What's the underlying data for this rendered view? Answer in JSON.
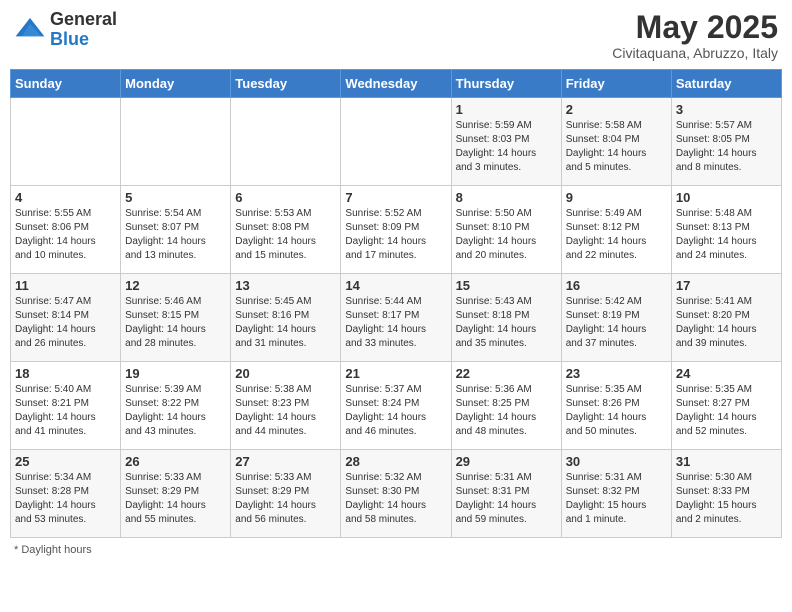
{
  "header": {
    "logo_general": "General",
    "logo_blue": "Blue",
    "month_title": "May 2025",
    "subtitle": "Civitaquana, Abruzzo, Italy"
  },
  "weekdays": [
    "Sunday",
    "Monday",
    "Tuesday",
    "Wednesday",
    "Thursday",
    "Friday",
    "Saturday"
  ],
  "weeks": [
    [
      {
        "day": "",
        "info": ""
      },
      {
        "day": "",
        "info": ""
      },
      {
        "day": "",
        "info": ""
      },
      {
        "day": "",
        "info": ""
      },
      {
        "day": "1",
        "info": "Sunrise: 5:59 AM\nSunset: 8:03 PM\nDaylight: 14 hours\nand 3 minutes."
      },
      {
        "day": "2",
        "info": "Sunrise: 5:58 AM\nSunset: 8:04 PM\nDaylight: 14 hours\nand 5 minutes."
      },
      {
        "day": "3",
        "info": "Sunrise: 5:57 AM\nSunset: 8:05 PM\nDaylight: 14 hours\nand 8 minutes."
      }
    ],
    [
      {
        "day": "4",
        "info": "Sunrise: 5:55 AM\nSunset: 8:06 PM\nDaylight: 14 hours\nand 10 minutes."
      },
      {
        "day": "5",
        "info": "Sunrise: 5:54 AM\nSunset: 8:07 PM\nDaylight: 14 hours\nand 13 minutes."
      },
      {
        "day": "6",
        "info": "Sunrise: 5:53 AM\nSunset: 8:08 PM\nDaylight: 14 hours\nand 15 minutes."
      },
      {
        "day": "7",
        "info": "Sunrise: 5:52 AM\nSunset: 8:09 PM\nDaylight: 14 hours\nand 17 minutes."
      },
      {
        "day": "8",
        "info": "Sunrise: 5:50 AM\nSunset: 8:10 PM\nDaylight: 14 hours\nand 20 minutes."
      },
      {
        "day": "9",
        "info": "Sunrise: 5:49 AM\nSunset: 8:12 PM\nDaylight: 14 hours\nand 22 minutes."
      },
      {
        "day": "10",
        "info": "Sunrise: 5:48 AM\nSunset: 8:13 PM\nDaylight: 14 hours\nand 24 minutes."
      }
    ],
    [
      {
        "day": "11",
        "info": "Sunrise: 5:47 AM\nSunset: 8:14 PM\nDaylight: 14 hours\nand 26 minutes."
      },
      {
        "day": "12",
        "info": "Sunrise: 5:46 AM\nSunset: 8:15 PM\nDaylight: 14 hours\nand 28 minutes."
      },
      {
        "day": "13",
        "info": "Sunrise: 5:45 AM\nSunset: 8:16 PM\nDaylight: 14 hours\nand 31 minutes."
      },
      {
        "day": "14",
        "info": "Sunrise: 5:44 AM\nSunset: 8:17 PM\nDaylight: 14 hours\nand 33 minutes."
      },
      {
        "day": "15",
        "info": "Sunrise: 5:43 AM\nSunset: 8:18 PM\nDaylight: 14 hours\nand 35 minutes."
      },
      {
        "day": "16",
        "info": "Sunrise: 5:42 AM\nSunset: 8:19 PM\nDaylight: 14 hours\nand 37 minutes."
      },
      {
        "day": "17",
        "info": "Sunrise: 5:41 AM\nSunset: 8:20 PM\nDaylight: 14 hours\nand 39 minutes."
      }
    ],
    [
      {
        "day": "18",
        "info": "Sunrise: 5:40 AM\nSunset: 8:21 PM\nDaylight: 14 hours\nand 41 minutes."
      },
      {
        "day": "19",
        "info": "Sunrise: 5:39 AM\nSunset: 8:22 PM\nDaylight: 14 hours\nand 43 minutes."
      },
      {
        "day": "20",
        "info": "Sunrise: 5:38 AM\nSunset: 8:23 PM\nDaylight: 14 hours\nand 44 minutes."
      },
      {
        "day": "21",
        "info": "Sunrise: 5:37 AM\nSunset: 8:24 PM\nDaylight: 14 hours\nand 46 minutes."
      },
      {
        "day": "22",
        "info": "Sunrise: 5:36 AM\nSunset: 8:25 PM\nDaylight: 14 hours\nand 48 minutes."
      },
      {
        "day": "23",
        "info": "Sunrise: 5:35 AM\nSunset: 8:26 PM\nDaylight: 14 hours\nand 50 minutes."
      },
      {
        "day": "24",
        "info": "Sunrise: 5:35 AM\nSunset: 8:27 PM\nDaylight: 14 hours\nand 52 minutes."
      }
    ],
    [
      {
        "day": "25",
        "info": "Sunrise: 5:34 AM\nSunset: 8:28 PM\nDaylight: 14 hours\nand 53 minutes."
      },
      {
        "day": "26",
        "info": "Sunrise: 5:33 AM\nSunset: 8:29 PM\nDaylight: 14 hours\nand 55 minutes."
      },
      {
        "day": "27",
        "info": "Sunrise: 5:33 AM\nSunset: 8:29 PM\nDaylight: 14 hours\nand 56 minutes."
      },
      {
        "day": "28",
        "info": "Sunrise: 5:32 AM\nSunset: 8:30 PM\nDaylight: 14 hours\nand 58 minutes."
      },
      {
        "day": "29",
        "info": "Sunrise: 5:31 AM\nSunset: 8:31 PM\nDaylight: 14 hours\nand 59 minutes."
      },
      {
        "day": "30",
        "info": "Sunrise: 5:31 AM\nSunset: 8:32 PM\nDaylight: 15 hours\nand 1 minute."
      },
      {
        "day": "31",
        "info": "Sunrise: 5:30 AM\nSunset: 8:33 PM\nDaylight: 15 hours\nand 2 minutes."
      }
    ]
  ],
  "footer": "Daylight hours"
}
